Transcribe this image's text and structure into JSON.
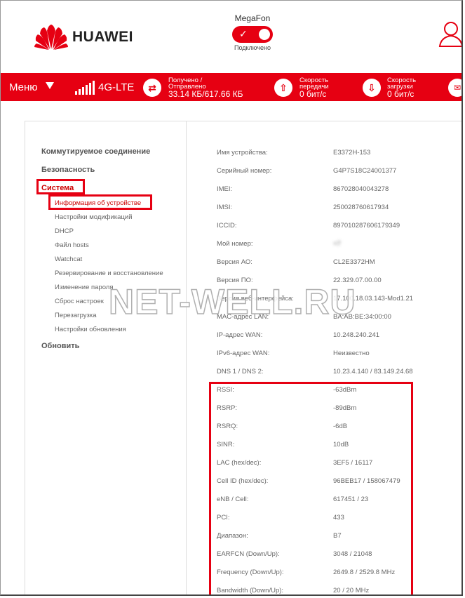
{
  "header": {
    "brand": "HUAWEI",
    "operator": "MegaFon",
    "connection_status": "Подключено"
  },
  "statusbar": {
    "menu_label": "Меню",
    "network_type": "4G-LTE",
    "received_sent_label_1": "Получено /",
    "received_sent_label_2": "Отправлено",
    "received_sent_value": "33.14 КБ/617.66 КБ",
    "upload_label_1": "Скорость",
    "upload_label_2": "передачи",
    "upload_value": "0 бит/с",
    "download_label_1": "Скорость",
    "download_label_2": "загрузки",
    "download_value": "0 бит/с"
  },
  "sidebar": {
    "dialup": "Коммутируемое соединение",
    "security": "Безопасность",
    "system": "Система",
    "items": [
      "Информация об устройстве",
      "Настройки модификаций",
      "DHCP",
      "Файл hosts",
      "Watchcat",
      "Резервирование и восстановление",
      "Изменение пароля",
      "Сброс настроек",
      "Перезагрузка",
      "Настройки обновления"
    ],
    "update": "Обновить"
  },
  "device_info": [
    {
      "label": "Имя устройства:",
      "value": "E3372H-153"
    },
    {
      "label": "Серийный номер:",
      "value": "G4P7S18C24001377"
    },
    {
      "label": "IMEI:",
      "value": "867028040043278"
    },
    {
      "label": "IMSI:",
      "value": "250028760617934"
    },
    {
      "label": "ICCID:",
      "value": "897010287606179349"
    },
    {
      "label": "Мой номер:",
      "value": "+7"
    },
    {
      "label": "Версия АО:",
      "value": "CL2E3372HM"
    },
    {
      "label": "Версия ПО:",
      "value": "22.329.07.00.00"
    },
    {
      "label": "Версия веб-интерфейса:",
      "value": "17.100.18.03.143-Mod1.21"
    },
    {
      "label": "MAC-адрес LAN:",
      "value": "BA:AB:BE:34:00:00"
    },
    {
      "label": "IP-адрес WAN:",
      "value": "10.248.240.241"
    },
    {
      "label": "IPv6-адрес WAN:",
      "value": "Неизвестно"
    },
    {
      "label": "DNS 1 / DNS 2:",
      "value": "10.23.4.140 / 83.149.24.68"
    },
    {
      "label": "RSSI:",
      "value": "-63dBm"
    },
    {
      "label": "RSRP:",
      "value": "-89dBm"
    },
    {
      "label": "RSRQ:",
      "value": "-6dB"
    },
    {
      "label": "SINR:",
      "value": "10dB"
    },
    {
      "label": "LAC (hex/dec):",
      "value": "3EF5 / 16117"
    },
    {
      "label": "Cell ID (hex/dec):",
      "value": "96BEB17 / 158067479"
    },
    {
      "label": "eNB / Cell:",
      "value": "617451 / 23"
    },
    {
      "label": "PCI:",
      "value": "433"
    },
    {
      "label": "Диапазон:",
      "value": "B7"
    },
    {
      "label": "EARFCN (Down/Up):",
      "value": "3048 / 21048"
    },
    {
      "label": "Frequency (Down/Up):",
      "value": "2649.8 / 2529.8 MHz"
    },
    {
      "label": "Bandwidth (Down/Up):",
      "value": "20 / 20 MHz"
    }
  ],
  "watermark": "NET-WELL.RU",
  "colors": {
    "brand_red": "#e60012"
  }
}
